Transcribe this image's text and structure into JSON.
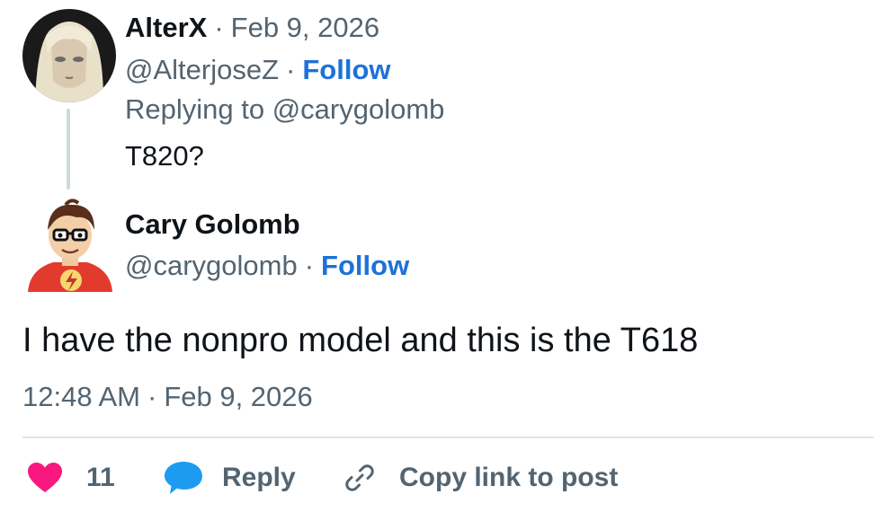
{
  "parent_post": {
    "display_name": "AlterX",
    "separator": "·",
    "date": "Feb 9, 2026",
    "handle": "@AlterjoseZ",
    "follow_label": "Follow",
    "replying_to": "Replying to @carygolomb",
    "text": "T820?"
  },
  "reply_post": {
    "display_name": "Cary Golomb",
    "handle": "@carygolomb",
    "separator": "·",
    "follow_label": "Follow",
    "text": "I have the nonpro model and this is the T618",
    "time": "12:48 AM",
    "time_separator": "·",
    "date": "Feb 9, 2026"
  },
  "actions": {
    "like_count": "11",
    "reply_label": "Reply",
    "copy_link_label": "Copy link to post"
  },
  "icons": {
    "like": "heart-icon",
    "reply": "speech-bubble-icon",
    "copy_link": "link-icon"
  },
  "colors": {
    "follow": "#1d72d8",
    "heart": "#f91880",
    "reply_bubble": "#1d9bf0",
    "muted_text": "#536471"
  }
}
